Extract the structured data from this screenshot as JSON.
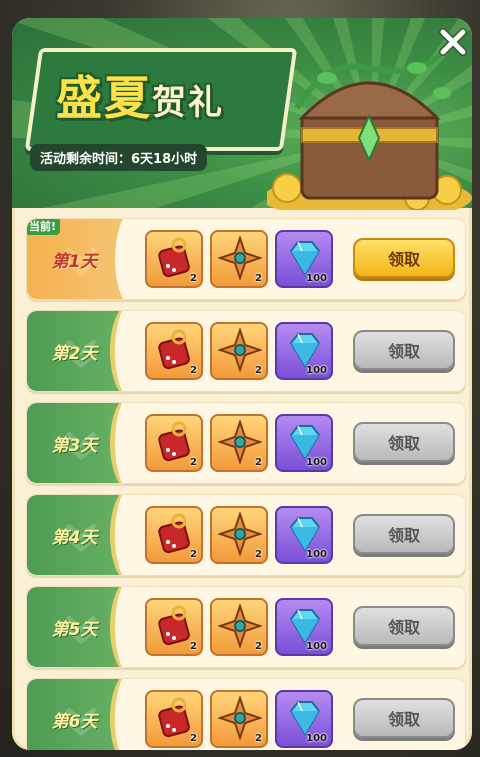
{
  "event": {
    "title_main": "盛夏",
    "title_sub": "贺礼",
    "timer_label": "活动剩余时间：",
    "timer_value": "6天18小时"
  },
  "today_badge": "当前!",
  "days": [
    {
      "label": "第1天",
      "state": "today",
      "button": "领取",
      "rewards": [
        {
          "icon": "red-pouch-icon",
          "count": "2"
        },
        {
          "icon": "shuriken-icon",
          "count": "2"
        },
        {
          "icon": "diamond-icon",
          "count": "100"
        }
      ]
    },
    {
      "label": "第2天",
      "state": "future",
      "button": "领取",
      "rewards": [
        {
          "icon": "red-pouch-icon",
          "count": "2"
        },
        {
          "icon": "shuriken-icon",
          "count": "2"
        },
        {
          "icon": "diamond-icon",
          "count": "100"
        }
      ]
    },
    {
      "label": "第3天",
      "state": "future",
      "button": "领取",
      "rewards": [
        {
          "icon": "red-pouch-icon",
          "count": "2"
        },
        {
          "icon": "shuriken-icon",
          "count": "2"
        },
        {
          "icon": "diamond-icon",
          "count": "100"
        }
      ]
    },
    {
      "label": "第4天",
      "state": "future",
      "button": "领取",
      "rewards": [
        {
          "icon": "red-pouch-icon",
          "count": "2"
        },
        {
          "icon": "shuriken-icon",
          "count": "2"
        },
        {
          "icon": "diamond-icon",
          "count": "100"
        }
      ]
    },
    {
      "label": "第5天",
      "state": "future",
      "button": "领取",
      "rewards": [
        {
          "icon": "red-pouch-icon",
          "count": "2"
        },
        {
          "icon": "shuriken-icon",
          "count": "2"
        },
        {
          "icon": "diamond-icon",
          "count": "100"
        }
      ]
    },
    {
      "label": "第6天",
      "state": "future",
      "button": "领取",
      "rewards": [
        {
          "icon": "red-pouch-icon",
          "count": "2"
        },
        {
          "icon": "shuriken-icon",
          "count": "2"
        },
        {
          "icon": "diamond-icon",
          "count": "100"
        }
      ]
    }
  ],
  "colors": {
    "accent_green": "#3d8f45",
    "claim_active": "#f3b51d",
    "claim_disabled": "#b9b9b9",
    "today_orange": "#f6b14f"
  }
}
